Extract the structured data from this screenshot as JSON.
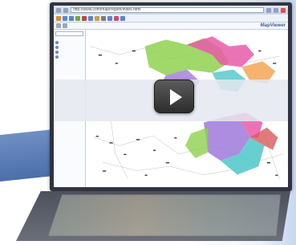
{
  "window": {
    "address": "http://www.com/map/region/index.html",
    "title": "Map viewer"
  },
  "toolbar": {
    "brand": "MapViewer"
  },
  "sidebar": {
    "items": [
      "",
      "",
      "",
      ""
    ]
  },
  "colors": {
    "frame": "#2f3440",
    "accent_blue": "#4c6ea9",
    "region_green": "#8fd14f",
    "region_pink": "#e75aa8",
    "region_purple": "#9f79d9",
    "region_cyan": "#4ec7c9"
  },
  "icons": [
    "back-icon",
    "forward-icon",
    "refresh-icon",
    "play-icon"
  ]
}
